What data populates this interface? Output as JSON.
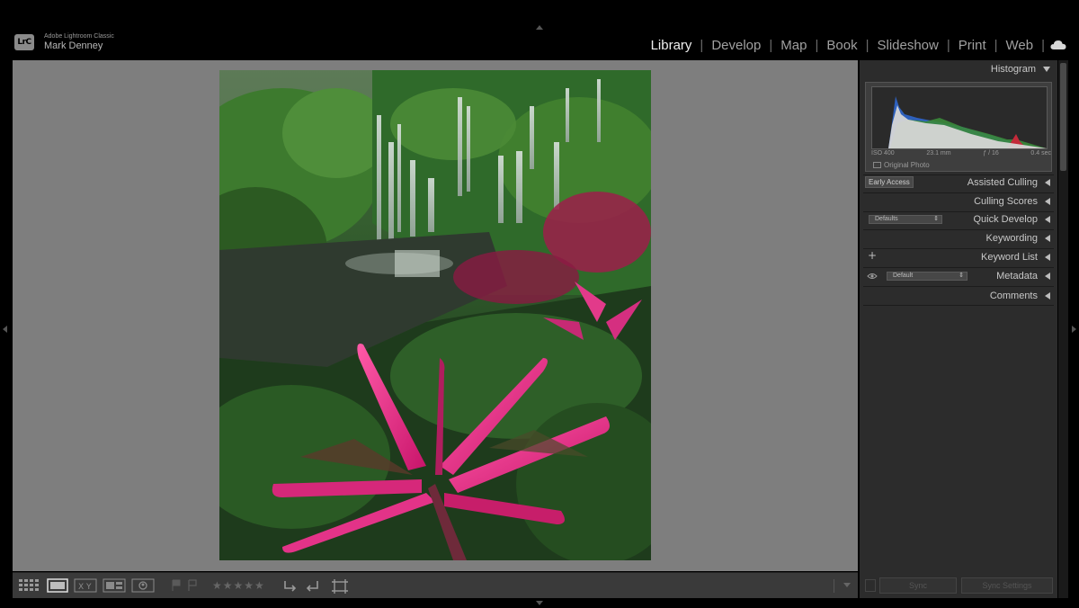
{
  "app": {
    "logo_text": "LrC",
    "app_name": "Adobe Lightroom Classic",
    "user_name": "Mark Denney"
  },
  "modules": [
    {
      "label": "Library",
      "active": true
    },
    {
      "label": "Develop",
      "active": false
    },
    {
      "label": "Map",
      "active": false
    },
    {
      "label": "Book",
      "active": false
    },
    {
      "label": "Slideshow",
      "active": false
    },
    {
      "label": "Print",
      "active": false
    },
    {
      "label": "Web",
      "active": false
    }
  ],
  "module_separator": "|",
  "panels": {
    "histogram": {
      "title": "Histogram",
      "iso": "ISO 400",
      "focal": "23.1 mm",
      "aperture": "ƒ / 16",
      "shutter": "0.4 sec",
      "original_photo": "Original Photo"
    },
    "assisted_culling": {
      "title": "Assisted Culling",
      "badge": "Early Access"
    },
    "culling_scores": {
      "title": "Culling Scores"
    },
    "quick_develop": {
      "title": "Quick Develop",
      "preset": "Defaults"
    },
    "keywording": {
      "title": "Keywording"
    },
    "keyword_list": {
      "title": "Keyword List",
      "add": "+"
    },
    "metadata": {
      "title": "Metadata",
      "preset": "Default"
    },
    "comments": {
      "title": "Comments"
    }
  },
  "bottom_buttons": {
    "sync": "Sync",
    "sync_settings": "Sync Settings"
  },
  "toolbar": {
    "stars": "★★★★★"
  },
  "colors": {
    "accent": "#e8e8e8",
    "viewer_bg": "#7e7e7e",
    "panel_bg": "#2c2c2c"
  }
}
